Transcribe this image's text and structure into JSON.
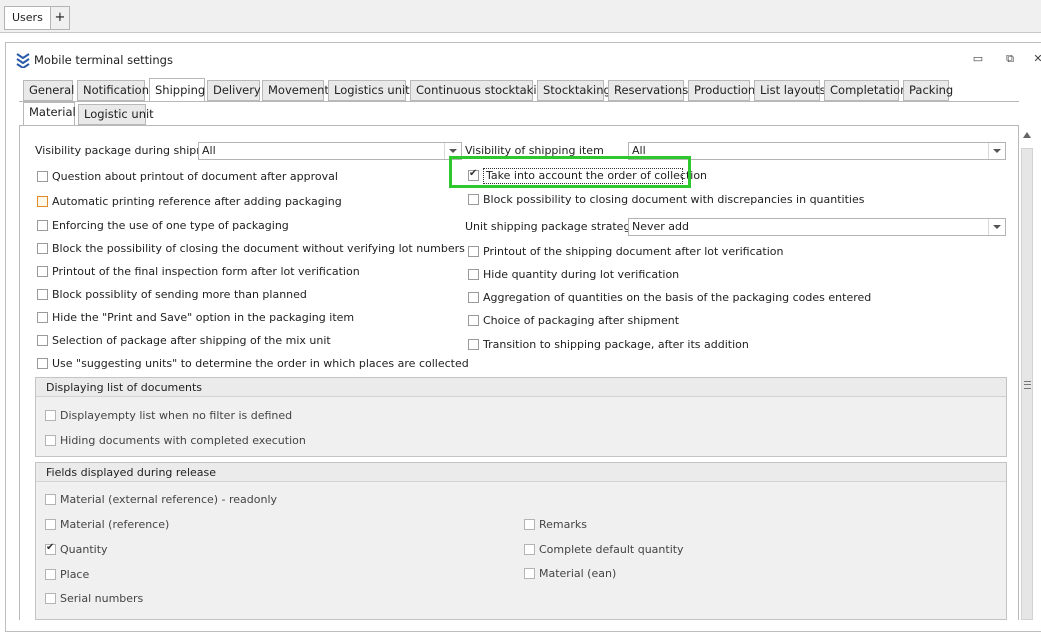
{
  "doc_tabs": {
    "users": "Users",
    "add": "+"
  },
  "window": {
    "title": "Mobile terminal settings"
  },
  "tabs": [
    "General",
    "Notifications",
    "Shipping",
    "Delivery",
    "Movement",
    "Logistics units",
    "Continuous stocktaking",
    "Stocktaking",
    "Reservations",
    "Production",
    "List layouts",
    "Completation",
    "Packing"
  ],
  "subtabs": [
    "Material",
    "Logistic unit"
  ],
  "left": {
    "visibility_package_label": "Visibility package during shipment",
    "visibility_package_value": "All",
    "checks": [
      "Question about printout of document after approval",
      "Automatic printing reference after adding packaging",
      "Enforcing the use of one type of packaging",
      "Block the possibility of closing the document without verifying lot numbers",
      "Printout of the final inspection form after lot verification",
      "Block possiblity of sending more than planned",
      "Hide the \"Print and Save\" option in the packaging item",
      "Selection of package after shipping of the mix unit",
      "Use \"suggesting units\" to determine the order in which places are collected"
    ]
  },
  "right": {
    "visibility_item_label": "Visibility of shipping item",
    "visibility_item_value": "All",
    "take_into_account": "Take into account the order of collection",
    "block_discrepancies": "Block possibility to closing document with discrepancies in quantities",
    "strategy_label": "Unit shipping package strategy",
    "strategy_value": "Never add",
    "checks": [
      "Printout of the shipping document after lot verification",
      "Hide quantity during lot verification",
      "Aggregation of quantities on the basis of the packaging codes entered",
      "Choice of packaging after shipment",
      "Transition to shipping package, after its addition"
    ]
  },
  "group_docs": {
    "title": "Displaying list of documents",
    "items": [
      "Displayempty list when no filter is defined",
      "Hiding documents with completed execution"
    ]
  },
  "group_fields": {
    "title": "Fields displayed during release",
    "left": [
      "Material (external reference) - readonly",
      "Material (reference)",
      "Quantity",
      "Place",
      "Serial numbers"
    ],
    "right": [
      "Remarks",
      "Complete default quantity",
      "Material (ean)"
    ]
  },
  "colors": {
    "highlight": "#2ec82e",
    "orange_checkbox": "#e08a2a"
  }
}
